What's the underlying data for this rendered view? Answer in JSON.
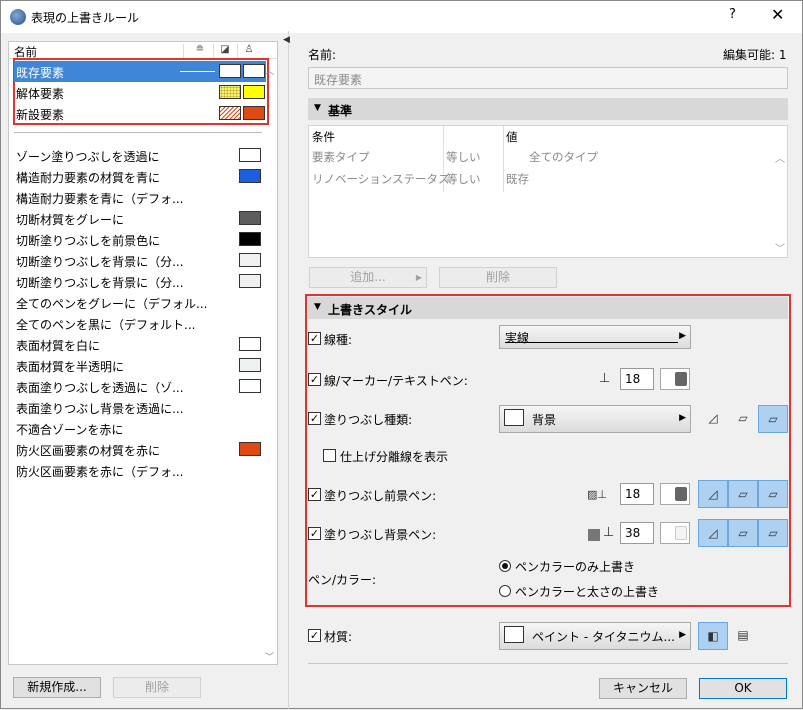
{
  "window": {
    "title": "表現の上書きルール",
    "help": "?",
    "close": "✕"
  },
  "left": {
    "header_name": "名前",
    "states": [
      {
        "label": "既存要素",
        "selected": true
      },
      {
        "label": "解体要素",
        "selected": false
      },
      {
        "label": "新設要素",
        "selected": false
      }
    ],
    "rules": [
      "ゾーン塗りつぶしを透過に",
      "構造耐力要素の材質を青に",
      "構造耐力要素を青に（デフォ...",
      "切断材質をグレーに",
      "切断塗りつぶしを前景色に",
      "切断塗りつぶしを背景に（分...",
      "切断塗りつぶしを背景に（分...",
      "全てのペンをグレーに（デフォル...",
      "全てのペンを黒に（デフォルト...",
      "表面材質を白に",
      "表面材質を半透明に",
      "表面塗りつぶしを透過に（ゾ...",
      "表面塗りつぶし背景を透過に...",
      "不適合ゾーンを赤に",
      "防火区画要素の材質を赤に",
      "防火区画要素を赤に（デフォ..."
    ],
    "new_button": "新規作成...",
    "delete_button": "削除"
  },
  "right": {
    "name_label": "名前:",
    "editable_label": "編集可能: 1",
    "name_value": "既存要素",
    "criteria": {
      "title": "基準",
      "col_condition": "条件",
      "col_value": "値",
      "rows": [
        {
          "condition": "要素タイプ",
          "op": "等しい",
          "value": "全てのタイプ"
        },
        {
          "condition": "リノベーションステータス",
          "op": "等しい",
          "value": "既存"
        }
      ],
      "add_button": "追加...",
      "delete_button": "削除"
    },
    "style": {
      "title": "上書きスタイル",
      "line_type_label": "線種:",
      "line_type_value": "実線",
      "line_pen_label": "線/マーカー/テキストペン:",
      "line_pen_value": "18",
      "fill_type_label": "塗りつぶし種類:",
      "fill_type_value": "背景",
      "show_sep_label": "仕上げ分離線を表示",
      "fill_fg_label": "塗りつぶし前景ペン:",
      "fill_fg_value": "18",
      "fill_bg_label": "塗りつぶし背景ペン:",
      "fill_bg_value": "38",
      "pen_color_label": "ペン/カラー:",
      "radio_color_only": "ペンカラーのみ上書き",
      "radio_color_weight": "ペンカラーと太さの上書き"
    },
    "material_label": "材質:",
    "material_value": "ペイント - タイタニウム...",
    "cancel_button": "キャンセル",
    "ok_button": "OK"
  },
  "colors": {
    "selection": "#3f86d6",
    "highlight_border": "#e23232",
    "blue_swatch": "#1a5fe0",
    "orange_swatch": "#e04a12",
    "yellow_swatch": "#ffff00"
  }
}
